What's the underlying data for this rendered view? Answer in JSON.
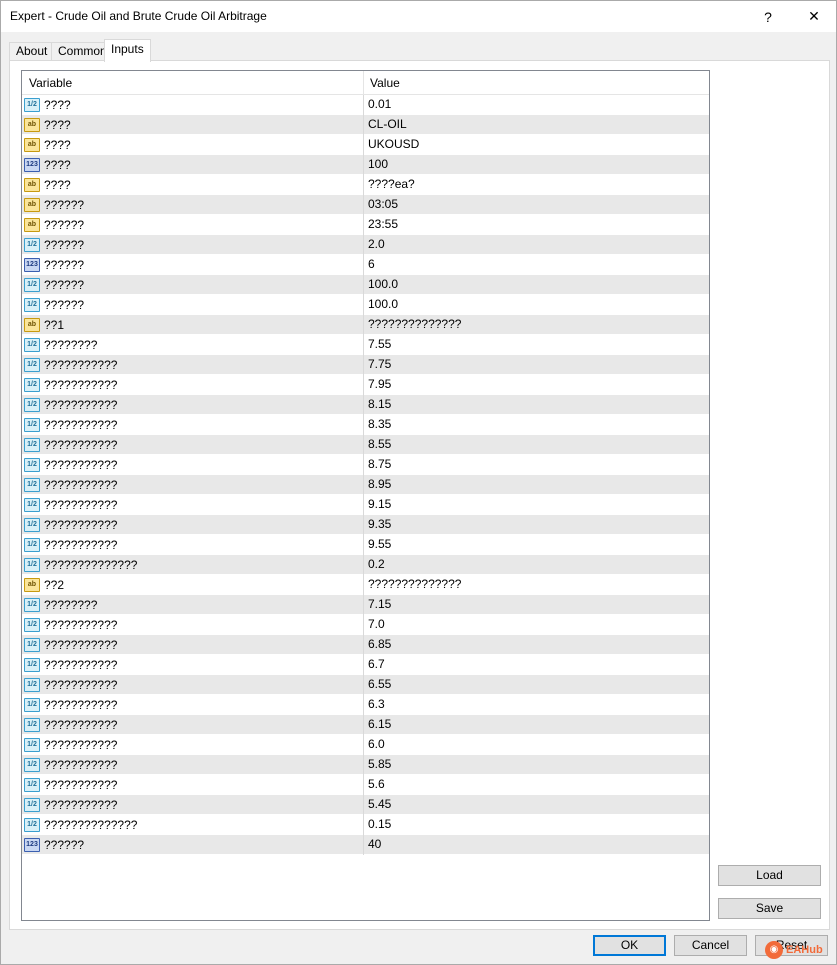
{
  "window": {
    "title": "Expert - Crude Oil and Brute Crude Oil Arbitrage",
    "help": "?",
    "close": "✕"
  },
  "tabs": [
    {
      "label": "About"
    },
    {
      "label": "Common"
    },
    {
      "label": "Inputs"
    }
  ],
  "grid": {
    "headers": {
      "variable": "Variable",
      "value": "Value"
    },
    "rows": [
      {
        "type": "double",
        "name": "????",
        "value": "0.01"
      },
      {
        "type": "string",
        "name": "????",
        "value": "CL-OIL"
      },
      {
        "type": "string",
        "name": "????",
        "value": "UKOUSD"
      },
      {
        "type": "int",
        "name": "????",
        "value": "100"
      },
      {
        "type": "string",
        "name": "????",
        "value": "????ea?"
      },
      {
        "type": "string",
        "name": "??????",
        "value": "03:05"
      },
      {
        "type": "string",
        "name": "??????",
        "value": "23:55"
      },
      {
        "type": "double",
        "name": "??????",
        "value": "2.0"
      },
      {
        "type": "int",
        "name": "??????",
        "value": "6"
      },
      {
        "type": "double",
        "name": "??????",
        "value": "100.0"
      },
      {
        "type": "double",
        "name": "??????",
        "value": "100.0"
      },
      {
        "type": "string",
        "name": "??1",
        "value": "??????????????"
      },
      {
        "type": "double",
        "name": "????????",
        "value": "7.55"
      },
      {
        "type": "double",
        "name": "???????????",
        "value": "7.75"
      },
      {
        "type": "double",
        "name": "???????????",
        "value": "7.95"
      },
      {
        "type": "double",
        "name": "???????????",
        "value": "8.15"
      },
      {
        "type": "double",
        "name": "???????????",
        "value": "8.35"
      },
      {
        "type": "double",
        "name": "???????????",
        "value": "8.55"
      },
      {
        "type": "double",
        "name": "???????????",
        "value": "8.75"
      },
      {
        "type": "double",
        "name": "???????????",
        "value": "8.95"
      },
      {
        "type": "double",
        "name": "???????????",
        "value": "9.15"
      },
      {
        "type": "double",
        "name": "???????????",
        "value": "9.35"
      },
      {
        "type": "double",
        "name": "???????????",
        "value": "9.55"
      },
      {
        "type": "double",
        "name": "??????????????",
        "value": "0.2"
      },
      {
        "type": "string",
        "name": "??2",
        "value": "??????????????"
      },
      {
        "type": "double",
        "name": "????????",
        "value": "7.15"
      },
      {
        "type": "double",
        "name": "???????????",
        "value": "7.0"
      },
      {
        "type": "double",
        "name": "???????????",
        "value": "6.85"
      },
      {
        "type": "double",
        "name": "???????????",
        "value": "6.7"
      },
      {
        "type": "double",
        "name": "???????????",
        "value": "6.55"
      },
      {
        "type": "double",
        "name": "???????????",
        "value": "6.3"
      },
      {
        "type": "double",
        "name": "???????????",
        "value": "6.15"
      },
      {
        "type": "double",
        "name": "???????????",
        "value": "6.0"
      },
      {
        "type": "double",
        "name": "???????????",
        "value": "5.85"
      },
      {
        "type": "double",
        "name": "???????????",
        "value": "5.6"
      },
      {
        "type": "double",
        "name": "???????????",
        "value": "5.45"
      },
      {
        "type": "double",
        "name": "??????????????",
        "value": "0.15"
      },
      {
        "type": "int",
        "name": "??????",
        "value": "40"
      }
    ]
  },
  "icons": {
    "double": "1/2",
    "string": "ab",
    "int": "123"
  },
  "buttons": {
    "load": "Load",
    "save": "Save",
    "ok": "OK",
    "cancel": "Cancel",
    "reset": "Reset"
  },
  "watermark": {
    "text": "EAHub"
  }
}
